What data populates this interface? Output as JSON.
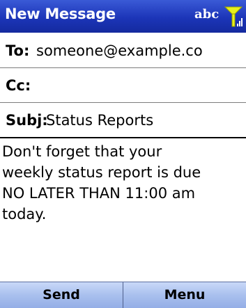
{
  "window": {
    "title": "New Message",
    "input_mode": "abc",
    "signal_icon": "signal-strength-icon"
  },
  "header": {
    "to_label": "To:",
    "to_value": "someone@example.co",
    "cc_label": "Cc:",
    "cc_value": "",
    "subject_label": "Subj:",
    "subject_value": "Status Reports"
  },
  "body": {
    "lines": [
      "Don't forget that your",
      "weekly status report is due",
      "NO LATER THAN 11:00 am",
      "today."
    ]
  },
  "softkeys": {
    "left_label": "Send",
    "right_label": "Menu"
  },
  "colors": {
    "title_bar": "#1c35b8",
    "softkey_bar": "#a9c0ee",
    "text": "#000000"
  }
}
